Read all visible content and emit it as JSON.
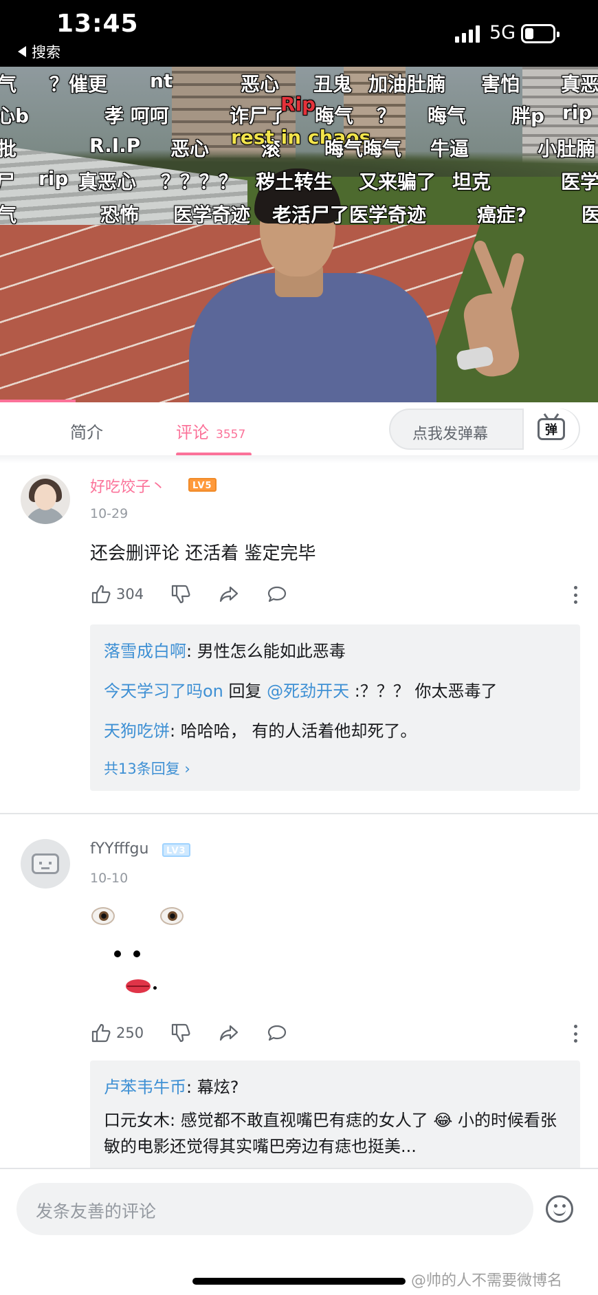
{
  "status_bar": {
    "time": "13:45",
    "back_label": "搜索",
    "network": "5G"
  },
  "video": {
    "danmaku": [
      {
        "text": "气",
        "style": "white"
      },
      {
        "text": "？催更",
        "style": "white"
      },
      {
        "text": "nt",
        "style": "white"
      },
      {
        "text": "恶心",
        "style": "white"
      },
      {
        "text": "丑鬼",
        "style": "white"
      },
      {
        "text": "加油肚腩",
        "style": "white"
      },
      {
        "text": "害怕",
        "style": "white"
      },
      {
        "text": "真恶",
        "style": "white"
      },
      {
        "text": "心b",
        "style": "white"
      },
      {
        "text": "孝 呵呵",
        "style": "white"
      },
      {
        "text": "诈尸了",
        "style": "white"
      },
      {
        "text": "Rip",
        "style": "red"
      },
      {
        "text": "晦气",
        "style": "white"
      },
      {
        "text": "？",
        "style": "white"
      },
      {
        "text": "晦气",
        "style": "white"
      },
      {
        "text": "胖p",
        "style": "white"
      },
      {
        "text": "rip",
        "style": "white"
      },
      {
        "text": "批",
        "style": "white"
      },
      {
        "text": "R.I.P",
        "style": "white"
      },
      {
        "text": "恶心",
        "style": "white"
      },
      {
        "text": "滚",
        "style": "white"
      },
      {
        "text": "rest in chaos",
        "style": "yellow"
      },
      {
        "text": "晦气晦气",
        "style": "white"
      },
      {
        "text": "牛逼",
        "style": "white"
      },
      {
        "text": "小肚腩",
        "style": "white"
      },
      {
        "text": "尸",
        "style": "white"
      },
      {
        "text": "rip",
        "style": "white"
      },
      {
        "text": "真恶心",
        "style": "white"
      },
      {
        "text": "？？？？",
        "style": "white"
      },
      {
        "text": "秽土转生",
        "style": "white"
      },
      {
        "text": "又来骗了",
        "style": "white"
      },
      {
        "text": "坦克",
        "style": "white"
      },
      {
        "text": "医学",
        "style": "white"
      },
      {
        "text": "气",
        "style": "white"
      },
      {
        "text": "恐怖",
        "style": "white"
      },
      {
        "text": "医学奇迹",
        "style": "white"
      },
      {
        "text": "老活尸了医学奇迹",
        "style": "white"
      },
      {
        "text": "癌症?",
        "style": "white"
      },
      {
        "text": "医",
        "style": "white"
      }
    ]
  },
  "tabs": {
    "intro": "简介",
    "comments": "评论",
    "comment_count": "3557",
    "danmaku_placeholder": "点我发弹幕",
    "danmaku_icon_label": "弹"
  },
  "comments": [
    {
      "username": "好吃饺子丶",
      "level": "LV5",
      "date": "10-29",
      "text": "还会删评论 还活着 鉴定完毕",
      "likes": "304",
      "replies": [
        {
          "name": "落雪成白啊",
          "sep": ": ",
          "text": "男性怎么能如此恶毒"
        },
        {
          "name": "今天学习了吗on",
          "sep": " 回复 ",
          "mention": "@死劲开天",
          "text": " :？？？ 你太恶毒了"
        },
        {
          "name": "天狗吃饼",
          "sep": ": ",
          "text": "哈哈哈， 有的人活着他却死了。"
        }
      ],
      "reply_total": "共13条回复 ›"
    },
    {
      "username": "fYYfffgu",
      "level": "LV3",
      "date": "10-10",
      "likes": "250",
      "replies": [
        {
          "name": "卢苯韦牛币",
          "sep": ": ",
          "text": "幕炫?"
        },
        {
          "name": "口元女木",
          "sep": ": ",
          "text": "感觉都不敢直视嘴巴有痣的女人了 😂 小的时候看张敏的电影还觉得其实嘴巴旁边有痣也挺美..."
        }
      ]
    }
  ],
  "bottom": {
    "input_placeholder": "发条友善的评论",
    "watermark": "@帅的人不需要微博名"
  },
  "colors": {
    "accent": "#fb7299",
    "link": "#3e90d4",
    "text": "#18191c",
    "muted": "#9499a0"
  }
}
